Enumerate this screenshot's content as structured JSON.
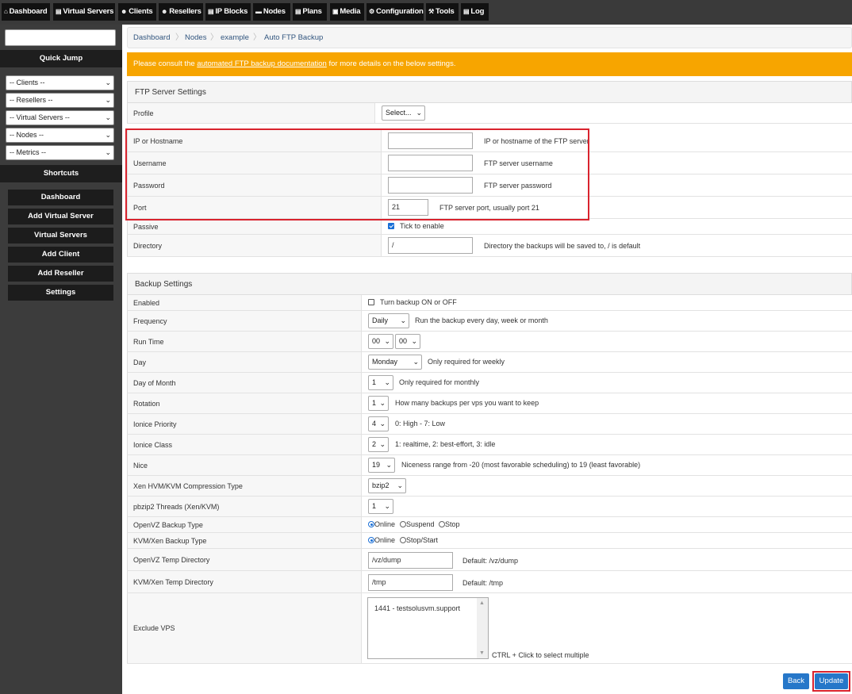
{
  "nav": [
    {
      "label": "Dashboard",
      "icon": "home-icon",
      "glyph": "⌂"
    },
    {
      "label": "Virtual Servers",
      "icon": "server-icon",
      "glyph": "▤"
    },
    {
      "label": "Clients",
      "icon": "users-icon",
      "glyph": "☻"
    },
    {
      "label": "Resellers",
      "icon": "user-icon",
      "glyph": "☻"
    },
    {
      "label": "IP Blocks",
      "icon": "ipblock-icon",
      "glyph": "▤"
    },
    {
      "label": "Nodes",
      "icon": "nodes-icon",
      "glyph": "▬"
    },
    {
      "label": "Plans",
      "icon": "plans-icon",
      "glyph": "▤"
    },
    {
      "label": "Media",
      "icon": "media-icon",
      "glyph": "▣"
    },
    {
      "label": "Configuration",
      "icon": "gear-icon",
      "glyph": "⚙"
    },
    {
      "label": "Tools",
      "icon": "wrench-icon",
      "glyph": "⚒"
    },
    {
      "label": "Log",
      "icon": "log-icon",
      "glyph": "▤"
    }
  ],
  "sidebar": {
    "quick_jump": "Quick Jump",
    "selects": [
      "-- Clients --",
      "-- Resellers --",
      "-- Virtual Servers --",
      "-- Nodes --",
      "-- Metrics --"
    ],
    "shortcuts_title": "Shortcuts",
    "shortcuts": [
      "Dashboard",
      "Add Virtual Server",
      "Virtual Servers",
      "Add Client",
      "Add Reseller",
      "Settings"
    ]
  },
  "breadcrumb": [
    "Dashboard",
    "Nodes",
    "example",
    "Auto FTP Backup"
  ],
  "notice": {
    "before": "Please consult the ",
    "link": "automated FTP backup documentation",
    "after": " for more details on the below settings."
  },
  "ftp": {
    "title": "FTP Server Settings",
    "profile_label": "Profile",
    "profile_value": "Select...",
    "host_label": "IP or Hostname",
    "host_value": "",
    "host_hint": "IP or hostname of the FTP server",
    "user_label": "Username",
    "user_value": "",
    "user_hint": "FTP server username",
    "pass_label": "Password",
    "pass_value": "",
    "pass_hint": "FTP server password",
    "port_label": "Port",
    "port_value": "21",
    "port_hint": "FTP server port, usually port 21",
    "passive_label": "Passive",
    "passive_checked": true,
    "passive_hint": "Tick to enable",
    "dir_label": "Directory",
    "dir_value": "/",
    "dir_hint": "Directory the backups will be saved to, / is default"
  },
  "backup": {
    "title": "Backup Settings",
    "enabled_label": "Enabled",
    "enabled_checked": false,
    "enabled_hint": "Turn backup ON or OFF",
    "freq_label": "Frequency",
    "freq_value": "Daily",
    "freq_hint": "Run the backup every day, week or month",
    "runtime_label": "Run Time",
    "runtime_hour": "00",
    "runtime_min": "00",
    "day_label": "Day",
    "day_value": "Monday",
    "day_hint": "Only required for weekly",
    "dom_label": "Day of Month",
    "dom_value": "1",
    "dom_hint": "Only required for monthly",
    "rotation_label": "Rotation",
    "rotation_value": "1",
    "rotation_hint": "How many backups per vps you want to keep",
    "ioprio_label": "Ionice Priority",
    "ioprio_value": "4",
    "ioprio_hint": "0: High - 7: Low",
    "ioclass_label": "Ionice Class",
    "ioclass_value": "2",
    "ioclass_hint": "1: realtime, 2: best-effort, 3: idle",
    "nice_label": "Nice",
    "nice_value": "19",
    "nice_hint": "Niceness range from -20 (most favorable scheduling) to 19 (least favorable)",
    "comp_label": "Xen HVM/KVM Compression Type",
    "comp_value": "bzip2",
    "pbzip_label": "pbzip2 Threads (Xen/KVM)",
    "pbzip_value": "1",
    "ovz_type_label": "OpenVZ Backup Type",
    "ovz_type_options": [
      "Online",
      "Suspend",
      "Stop"
    ],
    "kvm_type_label": "KVM/Xen Backup Type",
    "kvm_type_options": [
      "Online",
      "Stop/Start"
    ],
    "ovz_tmp_label": "OpenVZ Temp Directory",
    "ovz_tmp_value": "/vz/dump",
    "ovz_tmp_hint": "Default: /vz/dump",
    "kvm_tmp_label": "KVM/Xen Temp Directory",
    "kvm_tmp_value": "/tmp",
    "kvm_tmp_hint": "Default: /tmp",
    "exclude_label": "Exclude VPS",
    "exclude_options": [
      "1441 - testsolusvm.support"
    ],
    "exclude_hint": "CTRL + Click to select multiple"
  },
  "buttons": {
    "back": "Back",
    "update": "Update"
  },
  "colors": {
    "notice": "#f7a500",
    "button": "#2677c9",
    "highlight": "#d9232e"
  }
}
